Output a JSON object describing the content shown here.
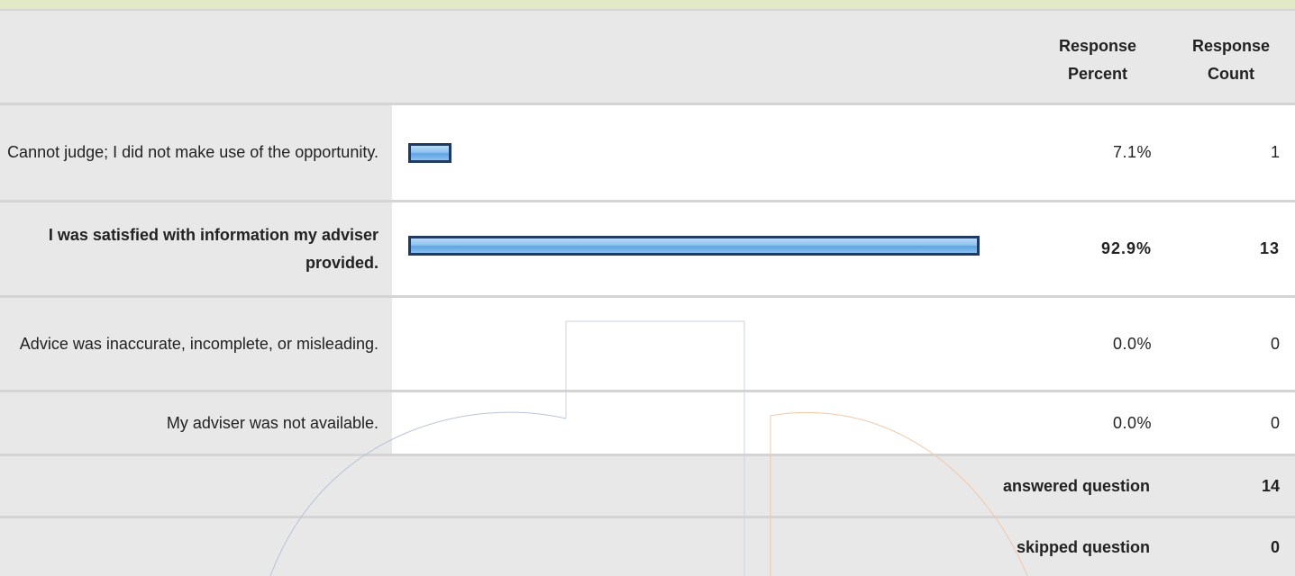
{
  "header": {
    "response_percent": "Response Percent",
    "response_count": "Response Count"
  },
  "answers": [
    {
      "label": "Cannot judge; I did not make use of the opportunity.",
      "percent": "7.1%",
      "count": "1",
      "bar_fraction": 0.071,
      "bold": false
    },
    {
      "label": "I was satisfied with information my adviser provided.",
      "percent": "92.9%",
      "count": "13",
      "bar_fraction": 0.929,
      "bold": true
    },
    {
      "label": "Advice was inaccurate, incomplete, or misleading.",
      "percent": "0.0%",
      "count": "0",
      "bar_fraction": 0.0,
      "bold": false
    },
    {
      "label": "My adviser was not available.",
      "percent": "0.0%",
      "count": "0",
      "bar_fraction": 0.0,
      "bold": false
    }
  ],
  "summary": {
    "answered_label": "answered question",
    "answered_value": "14",
    "skipped_label": "skipped question",
    "skipped_value": "0"
  },
  "colors": {
    "bar_border": "#1f3a63",
    "bar_fill": "#8ec3f0",
    "row_bg": "#e8e8e8",
    "cell_bg": "#ffffff",
    "top_band": "#e2e9c7"
  }
}
